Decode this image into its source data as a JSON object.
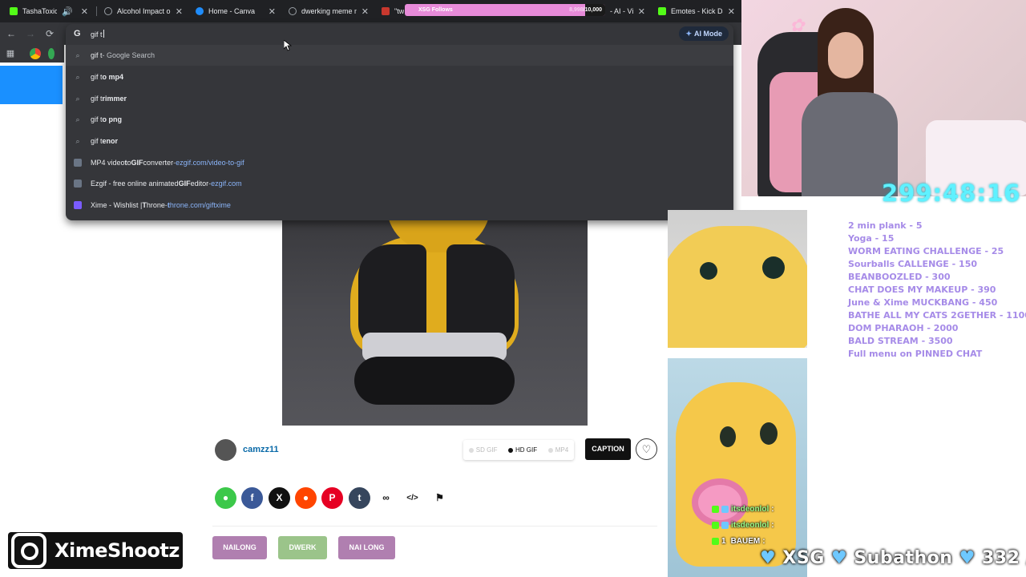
{
  "tabs": [
    {
      "title": "TashaToxic Stre",
      "icon": "kick-icon",
      "color": "#53fc18"
    },
    {
      "title": "Alcohol Impact on",
      "icon": "openai-icon",
      "color": "#9aa0a6"
    },
    {
      "title": "Home - Canva",
      "icon": "canva-icon",
      "color": "#1f8cfa"
    },
    {
      "title": "dwerking meme m",
      "icon": "globe-icon",
      "color": "#9aa0a6"
    },
    {
      "title": "\"twe",
      "icon": "tumblr-icon",
      "color": "#c8382e"
    },
    {
      "title": "- AI - Vi",
      "icon": "page-icon",
      "color": "#9aa0a6"
    },
    {
      "title": "Emotes - Kick Dash",
      "icon": "kick-icon",
      "color": "#53fc18"
    }
  ],
  "follows": {
    "label": "XSG Follows",
    "count": "8,998",
    "goal": "/10,000"
  },
  "omnibox": {
    "value": "gif t",
    "ai_mode": "AI Mode",
    "suggestions": [
      {
        "query": "gif t",
        "rest": " - Google Search",
        "type": "search"
      },
      {
        "prefix": "gif t",
        "bold": "o mp4",
        "type": "search"
      },
      {
        "prefix": "gif t",
        "bold": "rimmer",
        "type": "search"
      },
      {
        "prefix": "gif t",
        "bold": "o png",
        "type": "search"
      },
      {
        "prefix": "gif t",
        "bold": "enor",
        "type": "search"
      },
      {
        "title_a": "MP4 video ",
        "title_b": "t",
        "title_c": "o ",
        "title_d": "GIF",
        "title_e": " converter",
        "sep": " - ",
        "url": "ezgif.com/video-to-gif",
        "type": "site"
      },
      {
        "title_a": "Ezgif - free online animated ",
        "title_d": "GIF",
        "title_e": " editor",
        "sep": " - ",
        "url": "ezgif.com",
        "type": "site"
      },
      {
        "title_a": "Xime - Wishlist | ",
        "title_d": "T",
        "title_e": "hrone",
        "sep": " - ",
        "url_a": "t",
        "url": "hrone.com/gif",
        "url_b": "txime",
        "type": "site"
      }
    ]
  },
  "page": {
    "username": "camzz11",
    "quality": [
      "SD GIF",
      "HD GIF",
      "MP4"
    ],
    "caption": "CAPTION",
    "tags": [
      "NAILONG",
      "DWERK",
      "NAI LONG"
    ]
  },
  "stream": {
    "timer": "299:48:16",
    "menu": [
      "2 min plank  -  5",
      "Yoga  - 15",
      "WORM EATING CHALLENGE  -  25",
      "Sourballs CALLENGE  - 150",
      "BEANBOOZLED - 300",
      "CHAT DOES MY MAKEUP - 390",
      "June & Xime MUCKBANG - 450",
      "BATHE ALL MY CATS 2GETHER - 1100",
      "DOM PHARAOH - 2000",
      "BALD STREAM - 3500",
      "Full menu on PINNED CHAT"
    ],
    "chat": [
      {
        "badge": "1",
        "name": "itsdeonlol",
        "msg": ":"
      },
      {
        "badge": "1",
        "name": "itsdeonlol",
        "msg": ":"
      },
      {
        "badge": "1",
        "name": "BAUEM",
        "msg": ":"
      }
    ],
    "subathon": "XSG",
    "subathon_word": "Subathon",
    "subathon_count": "332 /",
    "instagram": "XimeShootz"
  },
  "colors": {
    "accent": "#8ab4f8",
    "menu": "#a68be8",
    "timer": "#5ff1ff",
    "tag_purple": "#b07fb0",
    "tag_green": "#9bc48a"
  }
}
